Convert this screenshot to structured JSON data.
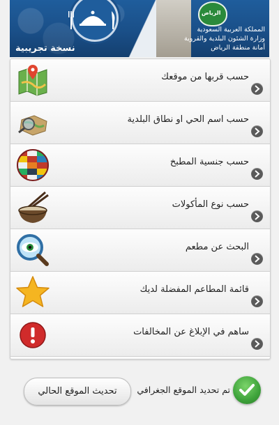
{
  "header": {
    "trial_label": "نسخة تجريبية",
    "emblem_text": "الرياض",
    "org_line1": "المملكة العربية السعودية",
    "org_line2": "وزارة الشئون البلدية والقروية",
    "org_line3": "أمانة منطقة الرياض"
  },
  "menu": {
    "items": [
      {
        "label": "حسب قربها من موقعك",
        "icon": "map-pin-icon"
      },
      {
        "label": "حسب اسم الحي او نطاق البلدية",
        "icon": "map-magnifier-icon"
      },
      {
        "label": "حسب جنسية المطبخ",
        "icon": "globe-flags-icon"
      },
      {
        "label": "حسب نوع المأكولات",
        "icon": "bowl-chopsticks-icon"
      },
      {
        "label": "البحث عن مطعم",
        "icon": "magnifier-eye-icon"
      },
      {
        "label": "قائمة المطاعم المفضلة لديك",
        "icon": "star-icon"
      },
      {
        "label": "ساهم في الإبلاغ عن المخالفات",
        "icon": "alert-icon"
      }
    ]
  },
  "footer": {
    "update_button": "تحديث الموقع الحالي",
    "status_text": "تم تحديد الموقع الجغرافي"
  },
  "colors": {
    "header_blue": "#1a4f88",
    "ok_green": "#3da23a",
    "alert_red": "#d02b2b",
    "star_yellow": "#f5b521"
  }
}
